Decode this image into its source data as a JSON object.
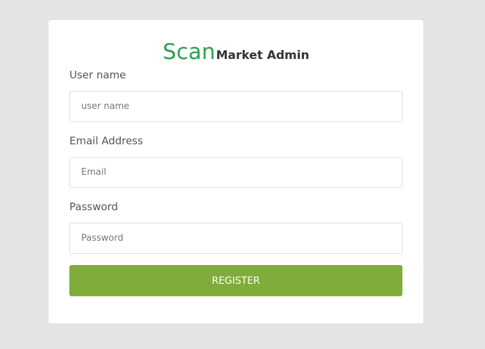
{
  "logo": {
    "brand": "Scan",
    "subtitle": "Market Admin"
  },
  "form": {
    "username": {
      "label": "User name",
      "placeholder": "user name",
      "value": ""
    },
    "email": {
      "label": "Email Address",
      "placeholder": "Email",
      "value": ""
    },
    "password": {
      "label": "Password",
      "placeholder": "Password",
      "value": ""
    },
    "submit_label": "REGISTER"
  },
  "colors": {
    "background": "#e4e4e4",
    "card": "#ffffff",
    "brand_green": "#2da24e",
    "button_green": "#7fac3b"
  }
}
